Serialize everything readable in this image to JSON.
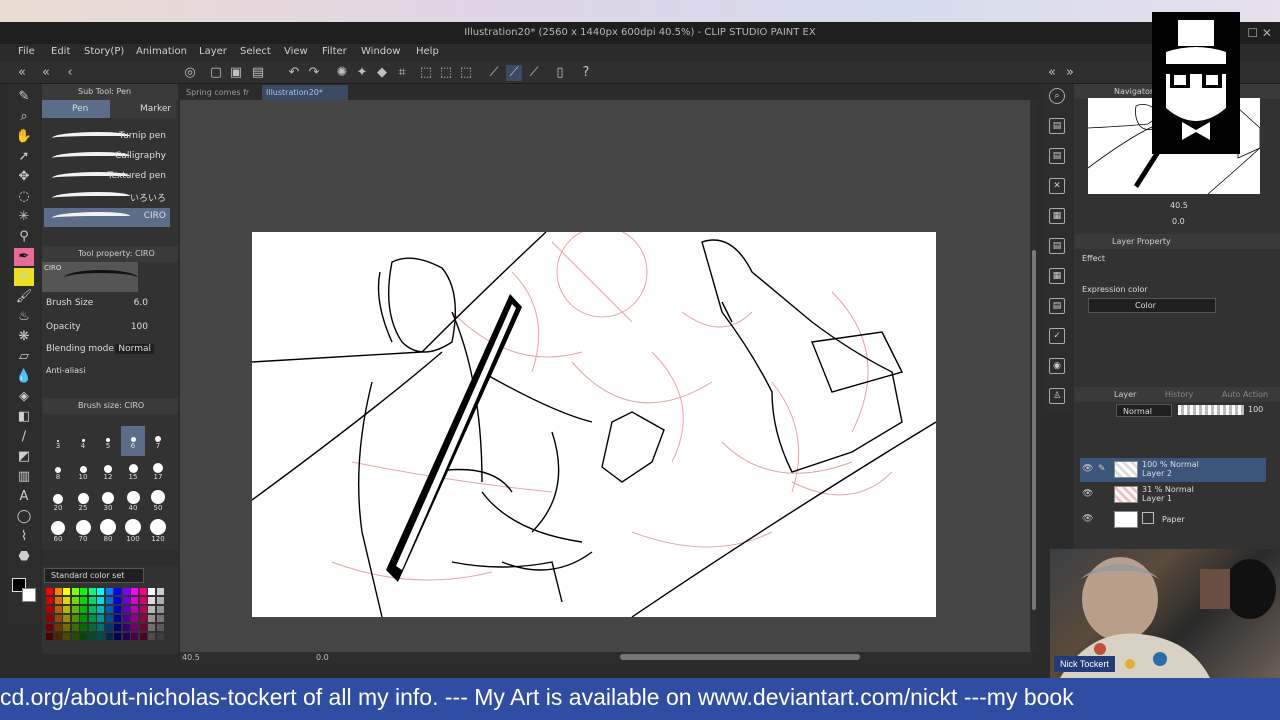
{
  "window": {
    "title": "Illustration20* (2560 x 1440px 600dpi 40.5%)  - CLIP STUDIO PAINT EX"
  },
  "menu": [
    "File",
    "Edit",
    "Story(P)",
    "Animation",
    "Layer",
    "Select",
    "View",
    "Filter",
    "Window",
    "Help"
  ],
  "doc_tabs": [
    {
      "label": "Spring comes fr",
      "active": false
    },
    {
      "label": "Illustration20*",
      "active": true
    }
  ],
  "sub_tool": {
    "header": "Sub Tool: Pen",
    "tabs": [
      "Pen",
      "Marker"
    ],
    "brushes": [
      "Turnip pen",
      "Calligraphy",
      "Textured pen",
      "いろいろ",
      "CIRO"
    ],
    "selected_brush": "CIRO"
  },
  "tool_property": {
    "header": "Tool property: CIRO",
    "preview_label": "CIRO",
    "brush_size_label": "Brush Size",
    "brush_size_value": "6.0",
    "opacity_label": "Opacity",
    "opacity_value": "100",
    "blending_label": "Blending mode",
    "blending_value": "Normal",
    "antialias_label": "Anti-aliasi"
  },
  "brush_size_panel": {
    "header": "Brush size: CIRO",
    "sizes": [
      "3",
      "4",
      "5",
      "6",
      "7",
      "8",
      "10",
      "12",
      "15",
      "17",
      "20",
      "25",
      "30",
      "40",
      "50",
      "60",
      "70",
      "80",
      "100",
      "120"
    ],
    "selected": "6"
  },
  "color_set": {
    "label": "Standard color set"
  },
  "status": {
    "zoom": "40.5",
    "angle": "0.0"
  },
  "navigator": {
    "header": "Navigator",
    "zoom": "40.5",
    "rotation": "0.0"
  },
  "layer_property": {
    "header": "Layer Property",
    "effect_label": "Effect",
    "expression_label": "Expression color",
    "expression_value": "Color"
  },
  "layer_panel": {
    "tabs": [
      "Layer",
      "History",
      "Auto Action"
    ],
    "blend_mode": "Normal",
    "opacity": "100",
    "layers": [
      {
        "mode": "100 % Normal",
        "name": "Layer 2",
        "selected": true
      },
      {
        "mode": "31 % Normal",
        "name": "Layer 1",
        "selected": false
      },
      {
        "mode": "",
        "name": "Paper",
        "selected": false
      }
    ]
  },
  "stream": {
    "cam_name": "Nick Tockert",
    "ticker": "cd.org/about-nicholas-tockert of all my info. --- My Art is available on www.deviantart.com/nickt ---my book"
  },
  "colors": {
    "accent_pink": "#e76b99",
    "selection_blue": "#3c557a",
    "ticker_bg": "#2f4ea3",
    "sketch_red": "#e8a4a4"
  }
}
